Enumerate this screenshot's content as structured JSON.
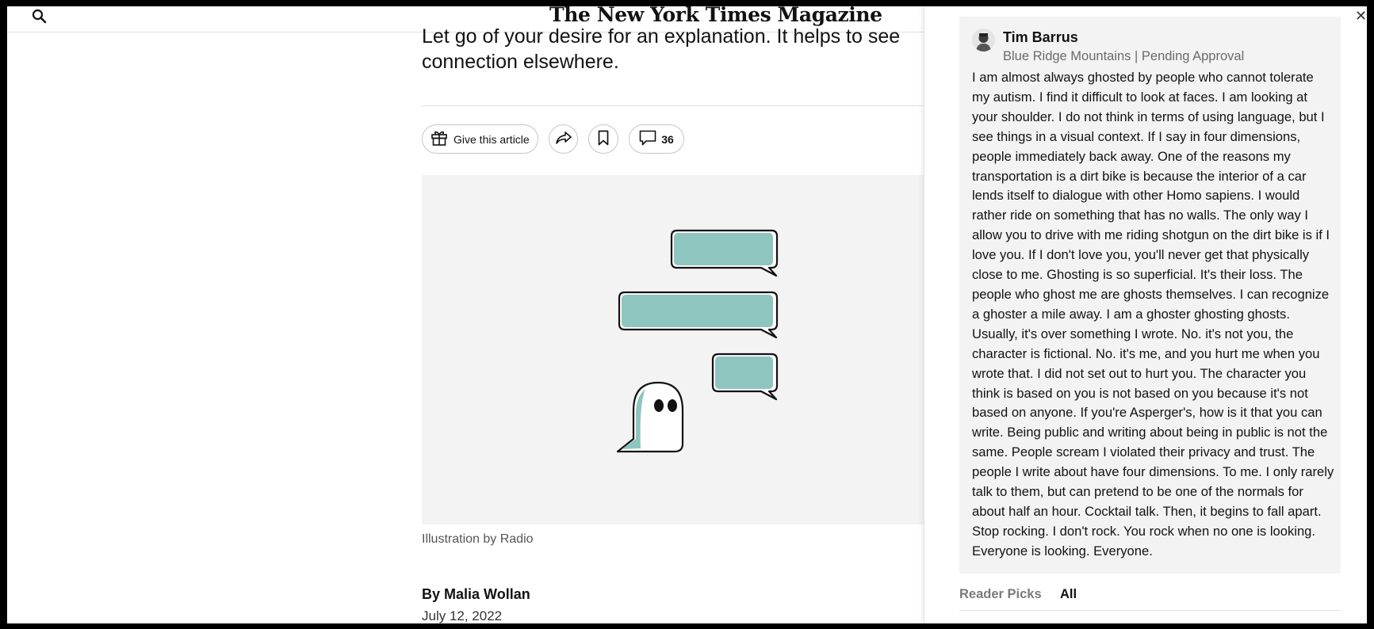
{
  "header": {
    "masthead": "The New York Times Magazine",
    "search_icon": "search-icon"
  },
  "article": {
    "summary": "Let go of your desire for an explanation. It helps to see connection elsewhere.",
    "actions": {
      "gift_label": "Give this article",
      "comments_count": "36"
    },
    "caption": "Illustration by Radio",
    "byline": "By Malia Wollan",
    "date": "July 12, 2022"
  },
  "comment_panel": {
    "close_icon": "close-icon",
    "comment": {
      "name": "Tim Barrus",
      "meta": "Blue Ridge Mountains | Pending Approval",
      "body": "I am almost always ghosted by people who cannot tolerate my autism. I find it difficult to look at faces. I am looking at your shoulder. I do not think in terms of using language, but I see things in a visual context. If I say in four dimensions, people immediately back away. One of the reasons my transportation is a dirt bike is because the interior of a car lends itself to dialogue with other Homo sapiens. I would rather ride on something that has no walls. The only way I allow you to drive with me riding shotgun on the dirt bike is if I love you. If I don't love you, you'll never get that physically close to me. Ghosting is so superficial. It's their loss. The people who ghost me are ghosts themselves. I can recognize a ghoster a mile away. I am a ghoster ghosting ghosts. Usually, it's over something I wrote. No. it's not you, the character is fictional. No. it's me, and you hurt me when you wrote that. I did not set out to hurt you. The character you think is based on you is not based on you because it's not based on anyone. If you're Asperger's, how is it that you can write. Being public and writing about being in public is not the same. People scream I violated their privacy and trust. The people I write about have four dimensions. To me. I only rarely talk to them, but can pretend to be one of the normals for about half an hour. Cocktail talk. Then, it begins to fall apart. Stop rocking. I don't rock. You rock when no one is looking. Everyone is looking. Everyone."
    },
    "tabs": [
      {
        "label": "Reader Picks",
        "active": false
      },
      {
        "label": "All",
        "active": true
      }
    ]
  },
  "colors": {
    "bubble_fill": "#8fc5bf",
    "illustration_bg": "#f3f3f3",
    "comment_bg": "#f3f3f3"
  }
}
